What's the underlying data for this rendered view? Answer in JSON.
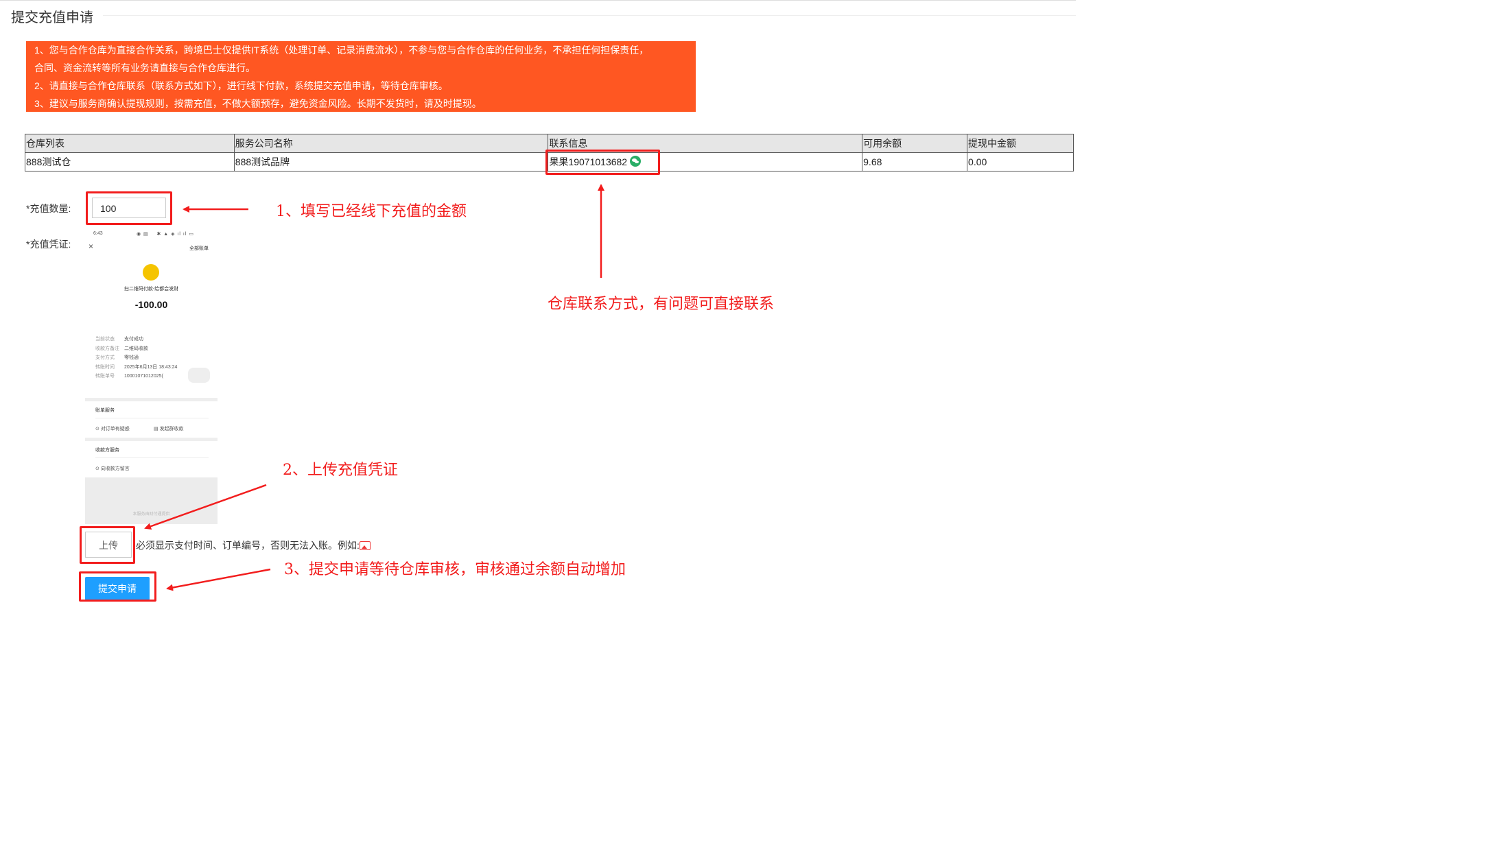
{
  "page": {
    "title": "提交充值申请"
  },
  "notice": {
    "lines": [
      "1、您与合作仓库为直接合作关系，跨境巴士仅提供IT系统（处理订单、记录消费流水），不参与您与合作仓库的任何业务，不承担任何担保责任，",
      "合同、资金流转等所有业务请直接与合作仓库进行。",
      "2、请直接与合作仓库联系（联系方式如下），进行线下付款，系统提交充值申请，等待仓库审核。",
      "3、建议与服务商确认提现规则，按需充值，不做大额预存，避免资金风险。长期不发货时，请及时提现。"
    ],
    "bg_color": "#ff5722"
  },
  "table": {
    "headers": [
      "仓库列表",
      "服务公司名称",
      "联系信息",
      "可用余额",
      "提现中金额"
    ],
    "rows": [
      {
        "warehouse": "888测试仓",
        "company": "888测试品牌",
        "contact": "果果19071013682",
        "balance": "9.68",
        "withdrawing": "0.00"
      }
    ]
  },
  "form": {
    "amount_label": "*充值数量:",
    "amount_value": "100",
    "voucher_label": "*充值凭证:",
    "upload_label": "上传",
    "hint": "必须显示支付时间、订单编号，否则无法入账。例如:",
    "submit_label": "提交申请"
  },
  "receipt": {
    "status_time": "6:43",
    "close": "×",
    "all_bills": "全部账单",
    "merchant": "扫二维码付款-给都会发财",
    "amount": "-100.00",
    "fields": [
      {
        "k": "当前状态",
        "v": "支付成功"
      },
      {
        "k": "收款方备注",
        "v": "二维码收款"
      },
      {
        "k": "支付方式",
        "v": "零钱通"
      },
      {
        "k": "转账时间",
        "v": "2025年6月13日 18:43:24"
      },
      {
        "k": "转账单号",
        "v": "10001071012025("
      }
    ],
    "section1": "账单服务",
    "link1": "对订单有疑惑",
    "link2": "发起群收款",
    "section2": "收款方服务",
    "link3": "向收款方留言",
    "footer": "本服务由财付通提供"
  },
  "annotations": {
    "a1": "1、填写已经线下充值的金额",
    "a2": "仓库联系方式，有问题可直接联系",
    "a3": "2、上传充值凭证",
    "a4": "3、提交申请等待仓库审核，审核通过余额自动增加"
  },
  "colors": {
    "annotation": "#f21d1d",
    "submit": "#1e9fff",
    "wechat": "#2aae67"
  },
  "icons": {
    "contact": "wechat-icon",
    "example": "image-icon"
  }
}
